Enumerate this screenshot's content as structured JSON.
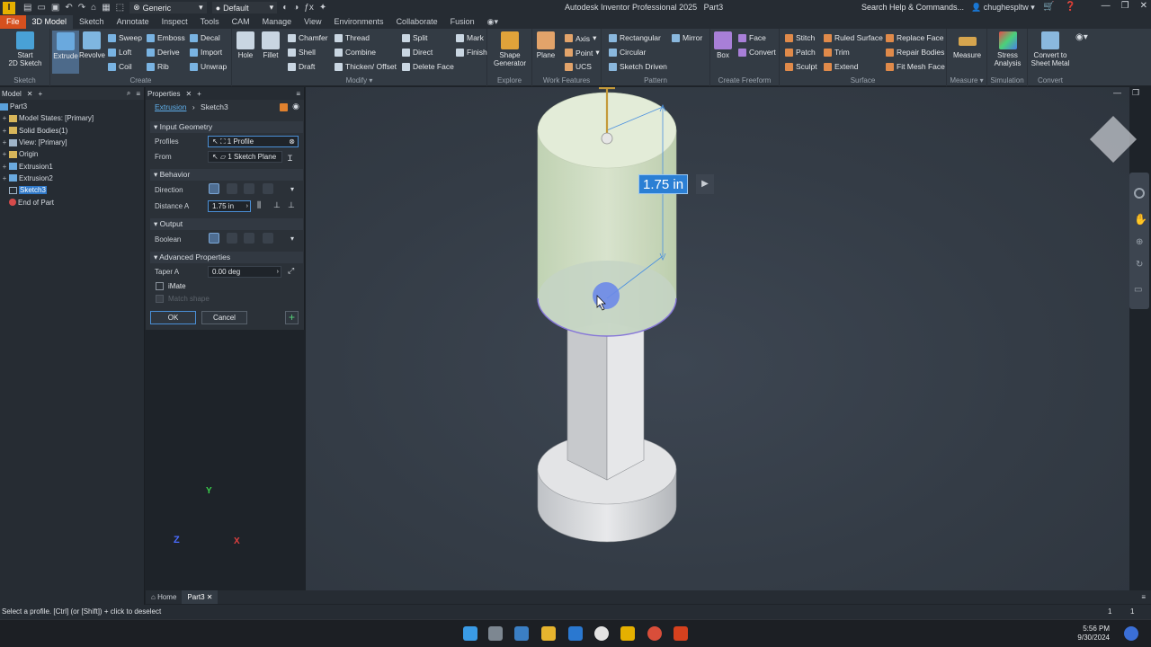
{
  "titlebar": {
    "app_title": "Autodesk Inventor Professional 2025",
    "doc_name": "Part3",
    "material": "Generic",
    "appearance": "Default",
    "search_placeholder": "Search Help & Commands...",
    "user": "chughespltw"
  },
  "menu": [
    "File",
    "3D Model",
    "Sketch",
    "Annotate",
    "Inspect",
    "Tools",
    "CAM",
    "Manage",
    "View",
    "Environments",
    "Collaborate",
    "Fusion"
  ],
  "ribbon": {
    "sketch": {
      "start_line1": "Start",
      "start_line2": "2D Sketch",
      "label": "Sketch"
    },
    "create": {
      "extrude": "Extrude",
      "revolve": "Revolve",
      "sweep": "Sweep",
      "loft": "Loft",
      "coil": "Coil",
      "emboss": "Emboss",
      "derive": "Derive",
      "rib": "Rib",
      "decal": "Decal",
      "import": "Import",
      "unwrap": "Unwrap",
      "label": "Create"
    },
    "modify": {
      "hole": "Hole",
      "fillet": "Fillet",
      "chamfer": "Chamfer",
      "shell": "Shell",
      "draft": "Draft",
      "thread": "Thread",
      "combine": "Combine",
      "thicken": "Thicken/ Offset",
      "split": "Split",
      "direct": "Direct",
      "delete_face": "Delete Face",
      "label": "Modify"
    },
    "explore": {
      "shape_line1": "Shape",
      "shape_line2": "Generator",
      "label": "Explore"
    },
    "work": {
      "plane": "Plane",
      "axis": "Axis",
      "point": "Point",
      "ucs": "UCS",
      "label": "Work Features"
    },
    "pattern": {
      "rectangular": "Rectangular",
      "circular": "Circular",
      "sketch_driven": "Sketch Driven",
      "mirror": "Mirror",
      "label": "Pattern"
    },
    "mark": {
      "mark": "Mark",
      "finish": "Finish"
    },
    "freeform": {
      "box": "Box",
      "face": "Face",
      "convert": "Convert",
      "label": "Create Freeform"
    },
    "surface": {
      "stitch": "Stitch",
      "patch": "Patch",
      "sculpt": "Sculpt",
      "ruled": "Ruled Surface",
      "trim": "Trim",
      "extend": "Extend",
      "replace": "Replace Face",
      "repair": "Repair Bodies",
      "fit_mesh": "Fit Mesh Face",
      "label": "Surface"
    },
    "measure": {
      "measure": "Measure",
      "label": "Measure"
    },
    "simulation": {
      "stress_line1": "Stress",
      "stress_line2": "Analysis",
      "label": "Simulation"
    },
    "convert": {
      "sheet_line1": "Convert to",
      "sheet_line2": "Sheet Metal",
      "label": "Convert"
    }
  },
  "browser": {
    "tab": "Model",
    "items": [
      "Part3",
      "Model States: [Primary]",
      "Solid Bodies(1)",
      "View: [Primary]",
      "Origin",
      "Extrusion1",
      "Extrusion2",
      "Sketch3",
      "End of Part"
    ]
  },
  "properties": {
    "tab": "Properties",
    "crumb_feature": "Extrusion",
    "crumb_sketch": "Sketch3",
    "sec_input": "Input Geometry",
    "profiles_label": "Profiles",
    "profiles_value": "1 Profile",
    "from_label": "From",
    "from_value": "1 Sketch Plane",
    "sec_behavior": "Behavior",
    "direction_label": "Direction",
    "distance_label": "Distance A",
    "distance_value": "1.75 in",
    "sec_output": "Output",
    "boolean_label": "Boolean",
    "sec_advanced": "Advanced Properties",
    "taper_label": "Taper A",
    "taper_value": "0.00 deg",
    "imate": "iMate",
    "match_shape": "Match shape",
    "ok": "OK",
    "cancel": "Cancel"
  },
  "viewport": {
    "dimension": "1.75 in",
    "axes": {
      "x": "X",
      "y": "Y",
      "z": "Z"
    }
  },
  "doc_tabs": {
    "home": "Home",
    "part": "Part3"
  },
  "status": {
    "message": "Select a profile. [Ctrl] (or [Shift]) + click to deselect",
    "count1": "1",
    "count2": "1"
  },
  "taskbar": {
    "time": "5:56 PM",
    "date": "9/30/2024"
  }
}
